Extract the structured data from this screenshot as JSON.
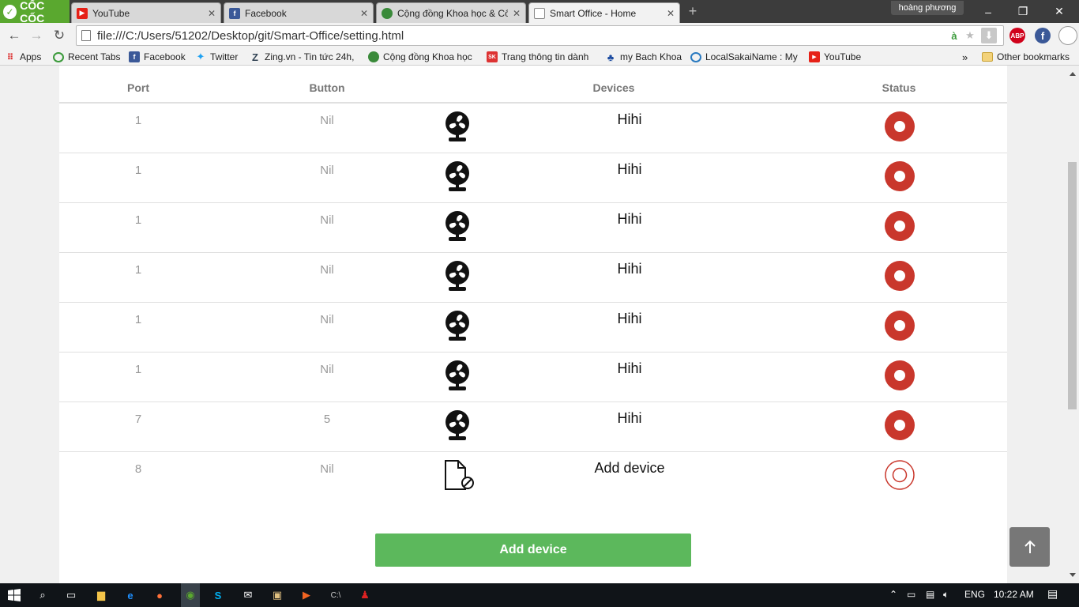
{
  "browser": {
    "brand": "CỐC CỐC",
    "tabs": [
      {
        "label": "YouTube",
        "icon": "youtube-icon",
        "color": "#e62117"
      },
      {
        "label": "Facebook",
        "icon": "facebook-icon",
        "color": "#3b5998"
      },
      {
        "label": "Cộng đồng Khoa học & Cô",
        "icon": "leaf-icon",
        "color": "#3a8a3a"
      },
      {
        "label": "Smart Office - Home",
        "icon": "page-icon",
        "color": "#888888",
        "active": true
      }
    ],
    "user": "hoàng phương",
    "window_buttons": {
      "minimize": "–",
      "restore": "❐",
      "close": "✕"
    },
    "nav": {
      "back": "←",
      "forward": "→",
      "reload": "↻"
    },
    "url": "file:///C:/Users/51202/Desktop/git/Smart-Office/setting.html",
    "extensions": {
      "star": "★",
      "download": "⬇",
      "abp": "ABP",
      "fb": "f"
    },
    "bookmarks": [
      {
        "label": "Apps",
        "icon": "apps-grid-icon"
      },
      {
        "label": "Recent Tabs",
        "icon": "recent-tabs-icon"
      },
      {
        "label": "Facebook",
        "icon": "facebook-icon"
      },
      {
        "label": "Twitter",
        "icon": "twitter-icon"
      },
      {
        "label": "Zing.vn - Tin tức 24h,",
        "icon": "zing-icon"
      },
      {
        "label": "Cộng đồng Khoa học",
        "icon": "leaf-icon"
      },
      {
        "label": "Trang thông tin dành",
        "icon": "news-icon"
      },
      {
        "label": "my Bach Khoa",
        "icon": "bachkhoa-icon"
      },
      {
        "label": "LocalSakaiName : My",
        "icon": "sakai-icon"
      },
      {
        "label": "YouTube",
        "icon": "youtube-icon"
      }
    ],
    "bookmarks_overflow": "»",
    "other_bookmarks": "Other bookmarks"
  },
  "table": {
    "headers": {
      "port": "Port",
      "button": "Button",
      "devices": "Devices",
      "status": "Status"
    },
    "rows": [
      {
        "port": "1",
        "button": "Nil",
        "device": "Hihi",
        "icon": "fan-icon",
        "status": "on"
      },
      {
        "port": "1",
        "button": "Nil",
        "device": "Hihi",
        "icon": "fan-icon",
        "status": "on"
      },
      {
        "port": "1",
        "button": "Nil",
        "device": "Hihi",
        "icon": "fan-icon",
        "status": "on"
      },
      {
        "port": "1",
        "button": "Nil",
        "device": "Hihi",
        "icon": "fan-icon",
        "status": "on"
      },
      {
        "port": "1",
        "button": "Nil",
        "device": "Hihi",
        "icon": "fan-icon",
        "status": "on"
      },
      {
        "port": "1",
        "button": "Nil",
        "device": "Hihi",
        "icon": "fan-icon",
        "status": "on"
      },
      {
        "port": "7",
        "button": "5",
        "device": "Hihi",
        "icon": "fan-icon",
        "status": "on"
      },
      {
        "port": "8",
        "button": "Nil",
        "device": "Add device",
        "icon": "no-file-icon",
        "status": "off"
      }
    ]
  },
  "add_button": "Add device",
  "colors": {
    "status_on": "#c9372c",
    "add_button": "#5cb85c"
  },
  "taskbar": {
    "lang": "ENG",
    "time": "10:22 AM"
  }
}
